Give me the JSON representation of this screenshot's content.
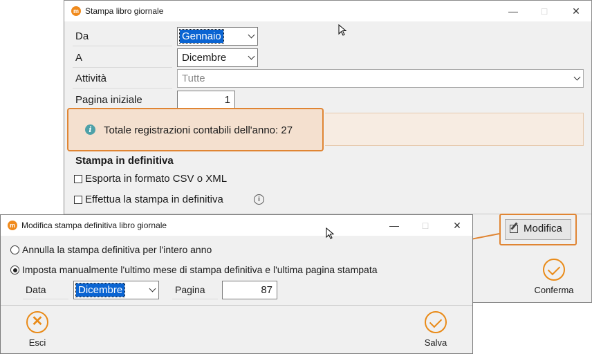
{
  "main_window": {
    "title": "Stampa libro giornale",
    "fields": {
      "da_label": "Da",
      "da_value": "Gennaio",
      "a_label": "A",
      "a_value": "Dicembre",
      "attivita_label": "Attività",
      "attivita_value": "Tutte",
      "pagina_label": "Pagina iniziale",
      "pagina_value": "1"
    },
    "info_message": "Totale registrazioni contabili dell'anno: 27",
    "section_title": "Stampa in definitiva",
    "checkboxes": {
      "export_label": "Esporta in formato CSV o XML",
      "definitiva_label": "Effettua la stampa in definitiva"
    },
    "modifica_label": "Modifica",
    "conferma_label": "Conferma"
  },
  "dialog": {
    "title": "Modifica stampa definitiva libro giornale",
    "radio_annulla": "Annulla la stampa definitiva per l'intero anno",
    "radio_imposta": "Imposta manualmente l'ultimo mese di stampa definitiva e l'ultima pagina stampata",
    "data_label": "Data",
    "data_value": "Dicembre",
    "pagina_label": "Pagina",
    "pagina_value": "87",
    "esci_label": "Esci",
    "salva_label": "Salva"
  },
  "colors": {
    "accent": "#e98a17",
    "highlight_border": "#e08533",
    "info_fill": "#f4e0cf",
    "selection": "#0a64d2"
  }
}
